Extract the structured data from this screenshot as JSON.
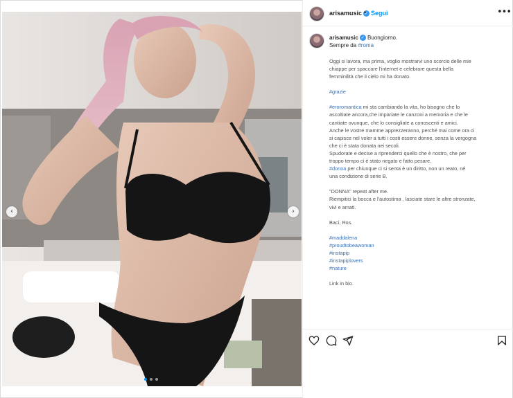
{
  "post": {
    "username": "arisamusic",
    "separator": "•",
    "follow_label": "Segui",
    "more_label": "•••"
  },
  "caption": {
    "username": "arisamusic",
    "greeting": "Buongiorno.",
    "line2_prefix": "Sempre da ",
    "line2_tag": "#roma",
    "paragraph1": [
      "Oggi si lavora, ma prima, voglio mostrarvi uno scorcio delle mie",
      "chiappe per spaccare l'internet e celebrare questa bella",
      "femminilità che il cielo mi ha donato."
    ],
    "tag_grazie": "#grazie",
    "paragraph2_tag": "#eroromantica",
    "paragraph2": [
      " mi sta cambiando la vita, ho bisogno che lo",
      "ascoltiate ancora,che impariate le canzoni a memoria e che le",
      "cantiate ovunque, che lo consigliate a conoscenti e amici.",
      "Anche le vostre mamme apprezzeranno, perché mai come ora ci",
      "si capisce nel voler a tutti i costi essere donne, senza la vergogna",
      "che ci è stata donata nei secoli.",
      "Spudorate e decise a riprenderci quello che è nostro, che per",
      "troppo tempo ci è stato negato e fatto pesare."
    ],
    "paragraph2_tag2": "#donna",
    "paragraph2_end": [
      " per chiunque ci si senta è un diritto, non un reato, né",
      "una condizione di serie B."
    ],
    "paragraph3": [
      "\"DONNA\" repeat after me.",
      "Riempitici la bocca e l'autostima , lasciate stare le altre stronzate,",
      "vivi e amati."
    ],
    "signoff": "Baci, Ros.",
    "hashtags": [
      "#maddalena",
      "#proudtobeawoman",
      "#instapip",
      "#instapiplovers",
      "#nature"
    ],
    "link": "Link in bio."
  },
  "media": {
    "prev_label": "‹",
    "next_label": "›",
    "slides": 3,
    "active_slide": 1
  },
  "icons": [
    "heart-icon",
    "comment-icon",
    "share-icon",
    "bookmark-icon",
    "verified-icon",
    "more-icon"
  ]
}
